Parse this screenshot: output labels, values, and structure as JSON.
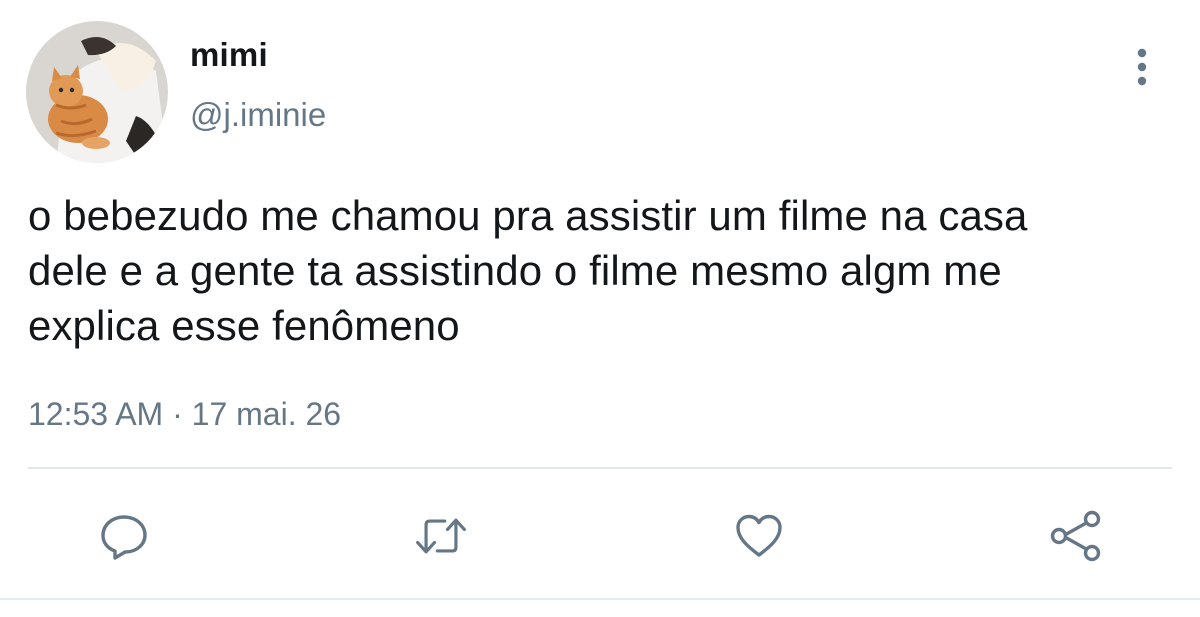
{
  "tweet": {
    "display_name": "mimi",
    "handle": "@j.iminie",
    "text": "o bebezudo me chamou pra assistir um filme na casa\ndele e a gente ta assistindo o filme mesmo algm me\nexplica esse fenômeno",
    "time": "12:53 AM",
    "separator": "·",
    "date": "17 mai. 26"
  },
  "icons": {
    "avatar": "cat-and-person-photo",
    "more": "more-vertical-icon",
    "reply": "reply-icon",
    "retweet": "retweet-icon",
    "like": "heart-icon",
    "share": "share-icon"
  },
  "colors": {
    "text": "#14171a",
    "secondary": "#657786",
    "icon": "#657786",
    "divider": "#e1e8ed"
  }
}
